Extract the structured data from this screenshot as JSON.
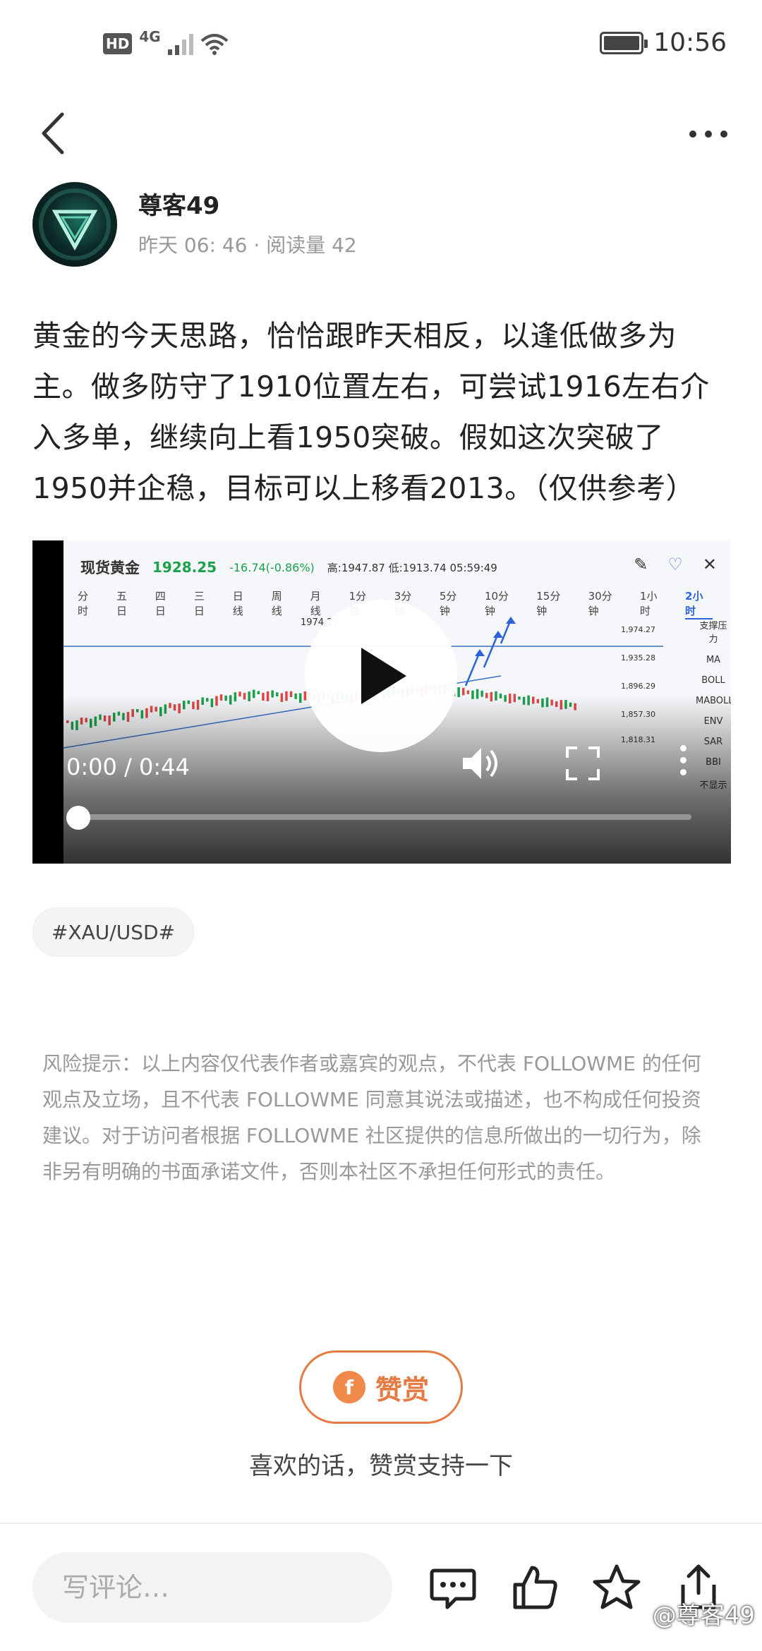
{
  "status_bar": {
    "hd": "HD",
    "network": "4G",
    "time": "10:56"
  },
  "author": {
    "name": "尊客49",
    "meta": "昨天 06: 46 · 阅读量 42"
  },
  "post": {
    "text": "黄金的今天思路，恰恰跟昨天相反，以逢低做多为主。做多防守了1910位置左右，可尝试1916左右介入多单，继续向上看1950突破。假如这次突破了1950并企稳，目标可以上移看2013。（仅供参考）"
  },
  "video": {
    "instrument": "现货黄金",
    "price": "1928.25",
    "change": "-16.74(-0.86%)",
    "high_low_time": "高:1947.87  低:1913.74  05:59:49",
    "periods": [
      "分时",
      "五日",
      "四日",
      "三日",
      "日线",
      "周线",
      "月线",
      "1分钟",
      "3分钟",
      "5分钟",
      "10分钟",
      "15分钟",
      "30分钟",
      "1小时",
      "2小时"
    ],
    "active_period": "2小时",
    "indicators": [
      "支撑压力",
      "MA",
      "BOLL",
      "MABOLL",
      "ENV",
      "SAR",
      "BBI",
      "不显示"
    ],
    "chart_peak_label": "1974.27",
    "price_axis": [
      "1,974.27",
      "1,935.28",
      "1,896.29",
      "1,857.30",
      "1,818.31"
    ],
    "time_display": "0:00 / 0:44",
    "progress": 0.0
  },
  "tag": "#XAU/USD#",
  "disclaimer": "风险提示：以上内容仅代表作者或嘉宾的观点，不代表 FOLLOWME 的任何观点及立场，且不代表 FOLLOWME 同意其说法或描述，也不构成任何投资建议。对于访问者根据 FOLLOWME 社区提供的信息所做出的一切行为，除非另有明确的书面承诺文件，否则本社区不承担任何形式的责任。",
  "reward": {
    "button_label": "赞赏",
    "coin_symbol": "f",
    "caption": "喜欢的话，赞赏支持一下"
  },
  "bottom_bar": {
    "comment_placeholder": "写评论…",
    "watermark": "@尊客49"
  }
}
